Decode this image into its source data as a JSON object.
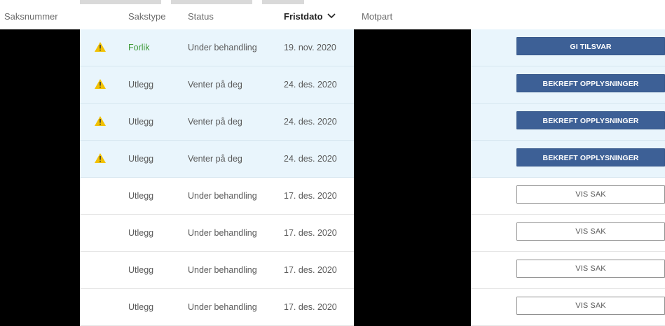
{
  "header": {
    "saksnummer": "Saksnummer",
    "sakstype": "Sakstype",
    "status": "Status",
    "fristdato": "Fristdato",
    "motpart": "Motpart"
  },
  "rows": [
    {
      "sakstype": "Forlik",
      "status": "Under behandling",
      "fristdato": "19. nov. 2020",
      "action": "GI TILSVAR",
      "warning": true,
      "highlight": true
    },
    {
      "sakstype": "Utlegg",
      "status": "Venter på deg",
      "fristdato": "24. des. 2020",
      "action": "BEKREFT OPPLYSNINGER",
      "warning": true,
      "highlight": true
    },
    {
      "sakstype": "Utlegg",
      "status": "Venter på deg",
      "fristdato": "24. des. 2020",
      "action": "BEKREFT OPPLYSNINGER",
      "warning": true,
      "highlight": true
    },
    {
      "sakstype": "Utlegg",
      "status": "Venter på deg",
      "fristdato": "24. des. 2020",
      "action": "BEKREFT OPPLYSNINGER",
      "warning": true,
      "highlight": true
    },
    {
      "sakstype": "Utlegg",
      "status": "Under behandling",
      "fristdato": "17. des. 2020",
      "action": "VIS SAK",
      "warning": false,
      "highlight": false
    },
    {
      "sakstype": "Utlegg",
      "status": "Under behandling",
      "fristdato": "17. des. 2020",
      "action": "VIS SAK",
      "warning": false,
      "highlight": false
    },
    {
      "sakstype": "Utlegg",
      "status": "Under behandling",
      "fristdato": "17. des. 2020",
      "action": "VIS SAK",
      "warning": false,
      "highlight": false
    },
    {
      "sakstype": "Utlegg",
      "status": "Under behandling",
      "fristdato": "17. des. 2020",
      "action": "VIS SAK",
      "warning": false,
      "highlight": false
    }
  ],
  "colors": {
    "highlight_row": "#e9f5fc",
    "primary_button": "#3d6096",
    "forlik_text": "#3f9a3a",
    "warning_icon": "#f2c100"
  },
  "icons": {
    "warning": "warning-triangle-icon",
    "sort": "chevron-down-icon"
  }
}
